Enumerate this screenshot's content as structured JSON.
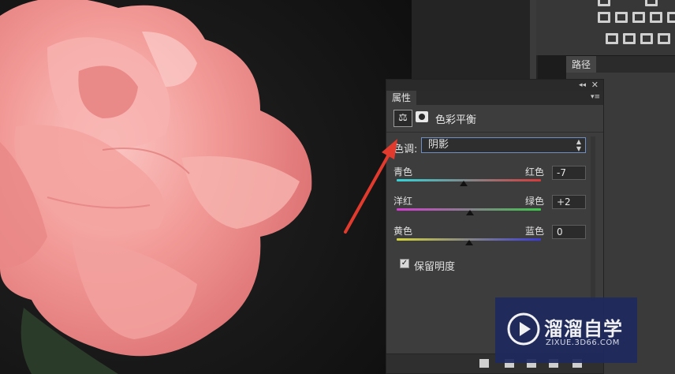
{
  "panels": {
    "paths_tab": "路径",
    "properties_tab": "属性",
    "collapse_glyph": "◂◂",
    "close_glyph": "✕",
    "menu_glyph": "▾≡"
  },
  "properties": {
    "title": "色彩平衡",
    "tone_label": "色调:",
    "tone_value": "阴影",
    "sliders": [
      {
        "left": "青色",
        "right": "红色",
        "value": "-7",
        "position": 0.465,
        "gradient": [
          "#31d4d9",
          "#d63a3a"
        ]
      },
      {
        "left": "洋红",
        "right": "绿色",
        "value": "+2",
        "position": 0.51,
        "gradient": [
          "#d43bd1",
          "#3cc84a"
        ]
      },
      {
        "left": "黄色",
        "right": "蓝色",
        "value": "0",
        "position": 0.5,
        "gradient": [
          "#d4d43a",
          "#3a3ad6"
        ]
      }
    ],
    "preserve_label": "保留明度",
    "preserve_checked": true
  },
  "watermark": {
    "brand": "溜溜自学",
    "url": "ZIXUE.3D66.COM"
  },
  "icons": {
    "color_balance": "balance-scale-icon",
    "mask": "mask-icon"
  }
}
